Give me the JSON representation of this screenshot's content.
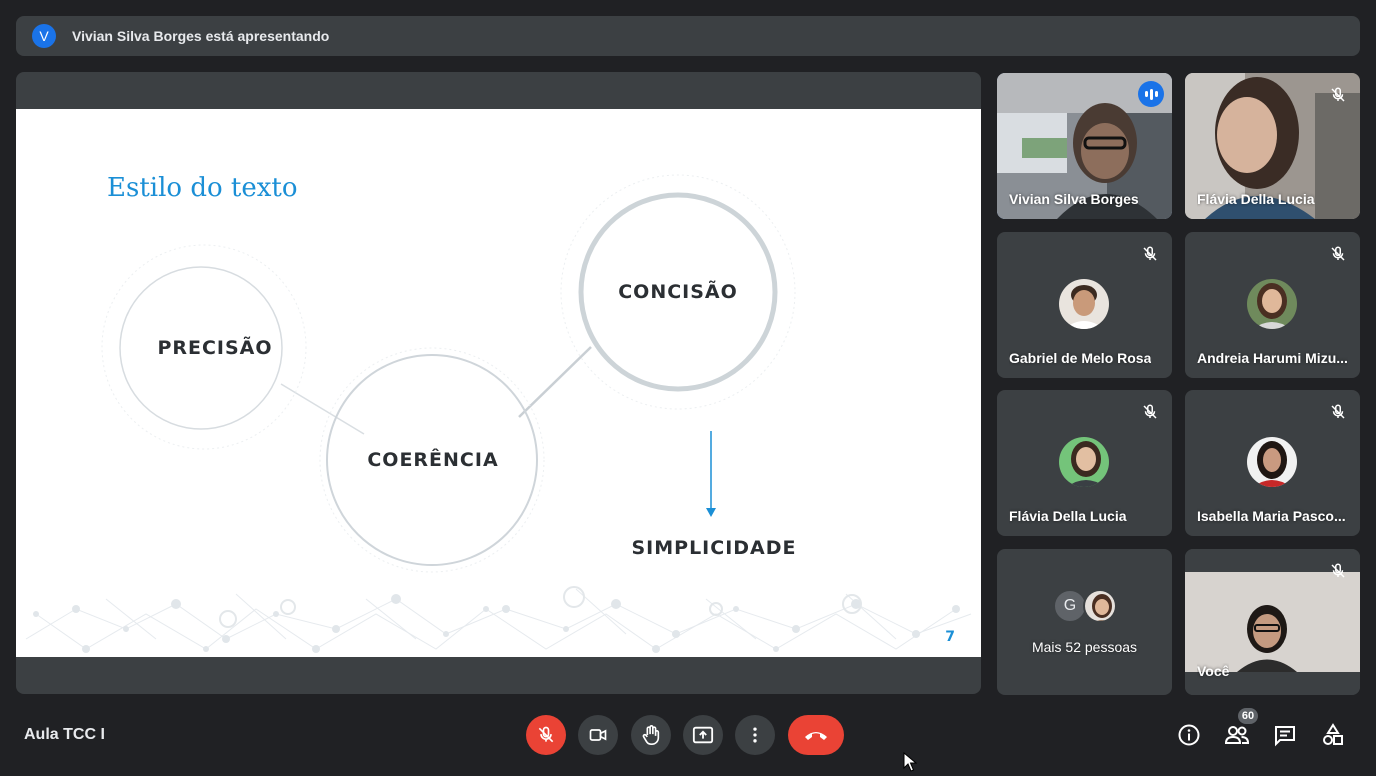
{
  "presenter_banner": {
    "avatar_letter": "V",
    "text": "Vivian Silva Borges está apresentando"
  },
  "slide": {
    "title": "Estilo do texto",
    "bubbles": [
      "PRECISÃO",
      "COERÊNCIA",
      "CONCISÃO",
      "SIMPLICIDADE"
    ],
    "page_number": "7",
    "accent_color": "#1b8fd6"
  },
  "participants": [
    {
      "name": "Vivian Silva Borges",
      "state": "speaking",
      "video": true
    },
    {
      "name": "Flávia Della Lucia",
      "state": "muted",
      "video": true
    },
    {
      "name": "Gabriel de Melo Rosa",
      "state": "muted",
      "video": false
    },
    {
      "name": "Andreia Harumi Mizu...",
      "state": "muted",
      "video": false
    },
    {
      "name": "Flávia Della Lucia",
      "state": "muted",
      "video": false
    },
    {
      "name": "Isabella Maria Pasco...",
      "state": "muted",
      "video": false
    },
    {
      "name": "Mais 52 pessoas",
      "avatar_letter": "G"
    },
    {
      "name": "Você",
      "state": "muted",
      "video": true
    }
  ],
  "meeting": {
    "title": "Aula TCC I",
    "participant_count": "60"
  },
  "controls": {
    "icons": [
      "mic-off-icon",
      "camera-icon",
      "raise-hand-icon",
      "present-icon",
      "more-options-icon",
      "end-call-icon"
    ],
    "right_icons": [
      "info-icon",
      "people-icon",
      "chat-icon",
      "activities-icon"
    ]
  }
}
